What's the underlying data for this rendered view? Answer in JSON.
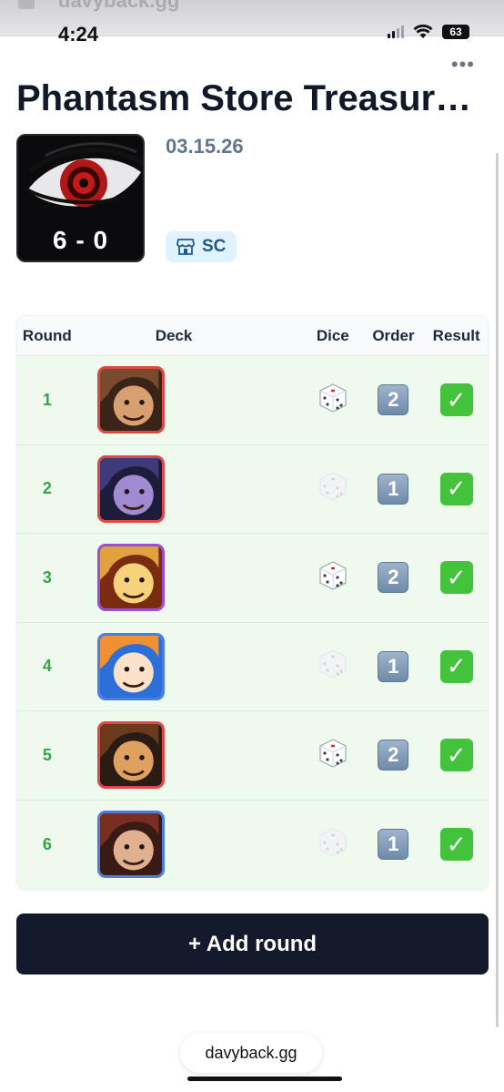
{
  "status_bar": {
    "site_title": "davyback.gg",
    "time": "4:24",
    "battery": "63"
  },
  "header": {
    "title": "Phantasm Store Treasur…",
    "record": "6 - 0",
    "date": "03.15.26",
    "store_tag": "SC"
  },
  "table": {
    "headers": {
      "round": "Round",
      "deck": "Deck",
      "dice": "Dice",
      "order": "Order",
      "result": "Result"
    },
    "rows": [
      {
        "round": "1",
        "deck_border": "#e04848",
        "dice_won": true,
        "order": "2",
        "result": "✓"
      },
      {
        "round": "2",
        "deck_border": "#e04848",
        "dice_won": false,
        "order": "1",
        "result": "✓"
      },
      {
        "round": "3",
        "deck_border": "#9b4dd6",
        "dice_won": true,
        "order": "2",
        "result": "✓"
      },
      {
        "round": "4",
        "deck_border": "#4a7fe0",
        "dice_won": false,
        "order": "1",
        "result": "✓"
      },
      {
        "round": "5",
        "deck_border": "#e04848",
        "dice_won": true,
        "order": "2",
        "result": "✓"
      },
      {
        "round": "6",
        "deck_border": "#4a7fe0",
        "dice_won": false,
        "order": "1",
        "result": "✓"
      }
    ]
  },
  "actions": {
    "add_round": "+ Add round"
  },
  "footer": {
    "url": "davyback.gg"
  },
  "colors": {
    "accent_dark": "#141a2c",
    "win_green": "#3aa14a",
    "row_bg": "#eefaee",
    "badge_bg": "#e0f2fe"
  }
}
